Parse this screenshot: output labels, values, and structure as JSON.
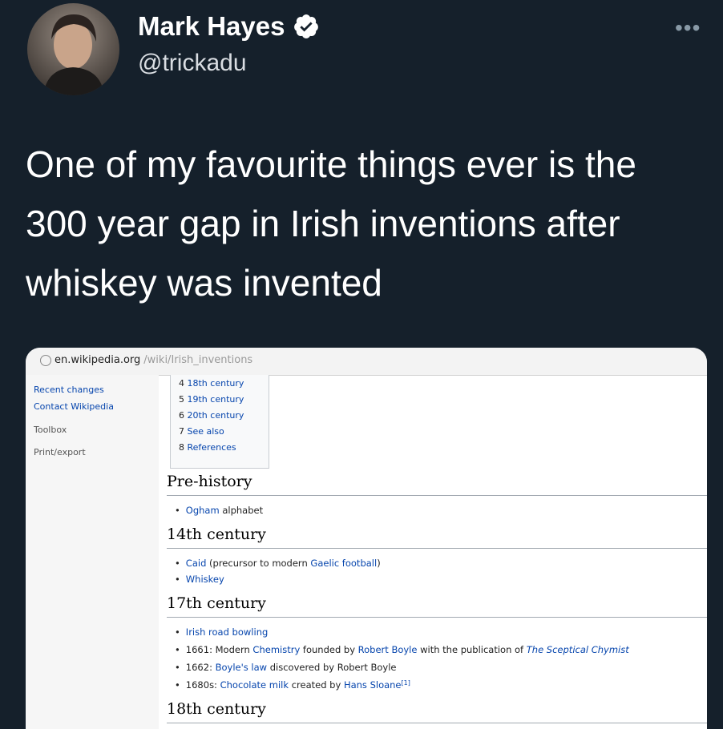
{
  "tweet": {
    "author_name": "Mark Hayes",
    "handle": "@trickadu",
    "more_glyph": "•••",
    "text": "One of my favourite things ever is the 300 year gap in Irish inventions after whiskey was invented",
    "colors": {
      "background": "#15202b",
      "verified": "#ffffff"
    }
  },
  "screenshot": {
    "url_domain": "en.wikipedia.org",
    "url_path": "/wiki/Irish_inventions",
    "sidebar": [
      "Recent changes",
      "Contact Wikipedia",
      "Toolbox",
      "Print/export"
    ],
    "toc": [
      {
        "num": "4",
        "label": "18th century"
      },
      {
        "num": "5",
        "label": "19th century"
      },
      {
        "num": "6",
        "label": "20th century"
      },
      {
        "num": "7",
        "label": "See also"
      },
      {
        "num": "8",
        "label": "References"
      }
    ],
    "sections": {
      "prehistory": {
        "title": "Pre-history",
        "items": [
          {
            "link": "Ogham",
            "rest": " alphabet"
          }
        ]
      },
      "c14": {
        "title": "14th century",
        "items": [
          {
            "link": "Caid",
            "mid": " (precursor to modern ",
            "link2": "Gaelic football",
            "end": ")"
          },
          {
            "link": "Whiskey"
          }
        ]
      },
      "c17": {
        "title": "17th century",
        "items": [
          {
            "link": "Irish road bowling"
          },
          {
            "year": "1661:",
            "t1": " Modern ",
            "l1": "Chemistry",
            "t2": " founded by ",
            "l2": "Robert Boyle",
            "t3": " with the publication of ",
            "l3": "The Sceptical Chymist"
          },
          {
            "year": "1662:",
            "l1": " Boyle's law",
            "t1": " discovered by Robert Boyle"
          },
          {
            "year": "1680s:",
            "l1": " Chocolate milk",
            "t1": " created by ",
            "l2": "Hans Sloane",
            "sup": "[1]"
          }
        ]
      },
      "c18": {
        "title": "18th century"
      }
    }
  }
}
